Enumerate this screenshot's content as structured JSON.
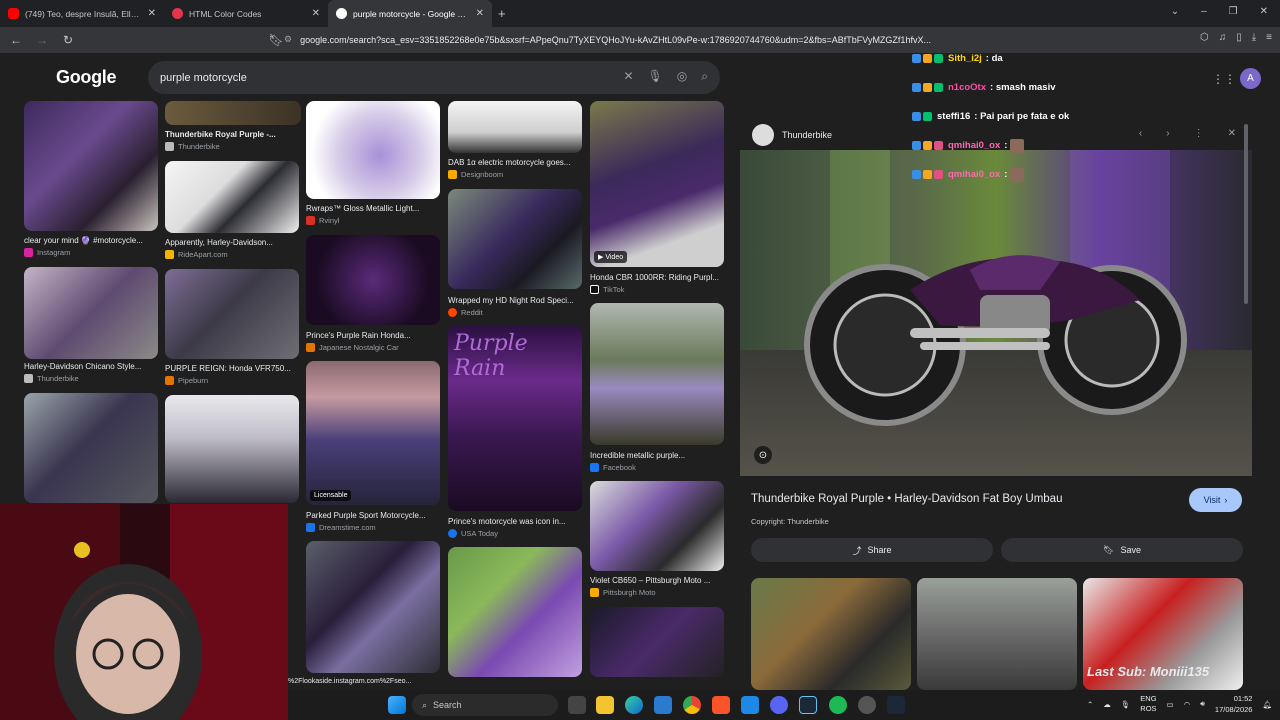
{
  "browser": {
    "tabs": [
      {
        "title": "(749) Teo, despre Insulă, Ella și iubita",
        "favicon_color": "#ff0000"
      },
      {
        "title": "HTML Color Codes",
        "favicon_color": "#e8334a"
      },
      {
        "title": "purple motorcycle - Google Search",
        "favicon_color": "#ffffff"
      }
    ],
    "url": "google.com/search?sca_esv=3351852268e0e75b&sxsrf=APpeQnu7TyXEYQHoJYu-kAvZHtL09vPe-w:1786920744760&udm=2&fbs=ABfTbFVyMZGZf1hfvX..."
  },
  "google": {
    "logo": "Google",
    "query": "purple motorcycle",
    "results": [
      {
        "caption": "clear your mind 🔮 #motorcycle...",
        "source": "Instagram",
        "src_color": "#d6249f"
      },
      {
        "caption": "Harley-Davidson Chicano Style...",
        "source": "Thunderbike",
        "src_color": "#bbbbbb"
      },
      {
        "caption": "Thunderbike Royal Purple -...",
        "source": "Thunderbike",
        "src_color": "#bbbbbb"
      },
      {
        "caption": "Apparently, Harley-Davidson...",
        "source": "RideApart.com",
        "src_color": "#f4b400"
      },
      {
        "caption": "PURPLE REIGN: Honda VFR750...",
        "source": "Pipeburn",
        "src_color": "#e37400"
      },
      {
        "caption": "Rwraps™ Gloss Metallic Light...",
        "source": "Rvinyl",
        "src_color": "#d93025"
      },
      {
        "caption": "Prince's Purple Rain Honda...",
        "source": "Japanese Nostalgic Car",
        "src_color": "#e37400"
      },
      {
        "caption": "Parked Purple Sport Motorcycle...",
        "source": "Dreamstime.com",
        "src_color": "#1a73e8"
      },
      {
        "caption": "DAB 1α electric motorcycle goes...",
        "source": "Designboom",
        "src_color": "#f9ab00"
      },
      {
        "caption": "Wrapped my HD Night Rod Speci...",
        "source": "Reddit",
        "src_color": "#ff4500"
      },
      {
        "caption": "Prince's motorcycle was icon in...",
        "source": "USA Today",
        "src_color": "#1a73e8"
      },
      {
        "caption": "Honda CBR 1000RR: Riding Purpl...",
        "source": "TikTok",
        "src_color": "#ffffff"
      },
      {
        "caption": "Incredible metallic purple...",
        "source": "Facebook",
        "src_color": "#1877f2"
      },
      {
        "caption": "Violet CB650 – Pittsburgh Moto ...",
        "source": "Pittsburgh Moto",
        "src_color": "#f9ab00"
      }
    ],
    "badges": {
      "video": "Video",
      "licensable": "Licensable"
    },
    "overlay_url": "%2Flookaside.instagram.com%2Fseo..."
  },
  "panel": {
    "source": "Thunderbike",
    "title": "Thunderbike Royal Purple • Harley-Davidson Fat Boy Umbau",
    "visit": "Visit",
    "copyright": "Copyright: Thunderbike",
    "share": "Share",
    "save": "Save"
  },
  "chat": [
    {
      "user": "Sith_i2j",
      "msg": "da",
      "color": "#ffd700"
    },
    {
      "user": "n1coOtx",
      "msg": "smash masiv",
      "color": "#ff4da6"
    },
    {
      "user": "steffi16",
      "msg": "Pai pari pe fata e ok",
      "color": "#ffffff"
    },
    {
      "user": "qmihai0_ox",
      "msg": "",
      "color": "#ff69b4"
    },
    {
      "user": "qmihai0_ox",
      "msg": "",
      "color": "#ff69b4"
    }
  ],
  "account_initial": "A",
  "stream_overlay": "Last Sub: Moniii135",
  "taskbar": {
    "search": "Search",
    "lang_top": "ENG",
    "lang_bottom": "ROS",
    "time": "01:52",
    "date": "17/08/2026"
  }
}
